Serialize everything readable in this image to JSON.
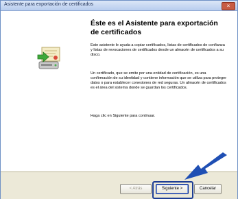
{
  "window": {
    "title": "Asistente para exportación de certificados",
    "close_label": "×"
  },
  "wizard": {
    "heading": "Éste es el Asistente para exportación de certificados",
    "paragraphs": [
      "Este asistente le ayuda a copiar certificados, listas de certificados de confianza y listas de revocaciones de certificados desde un almacén de certificados a su disco.",
      "Un certificado, que se emite por una entidad de certificación, es una confirmación de su identidad y contiene información que se utiliza para proteger datos o para establecer conexiones de red seguras. Un almacén de certificados es el área del sistema donde se guardan los certificados.",
      "Haga clic en Siguiente para continuar."
    ]
  },
  "buttons": {
    "back": "< Atrás",
    "next": "Siguiente >",
    "cancel": "Cancelar"
  },
  "icons": {
    "certificate": "certificate-export-icon",
    "arrow": "pointer-arrow-icon"
  },
  "colors": {
    "arrow": "#1f4fb4",
    "highlight": "#1c3d95"
  }
}
